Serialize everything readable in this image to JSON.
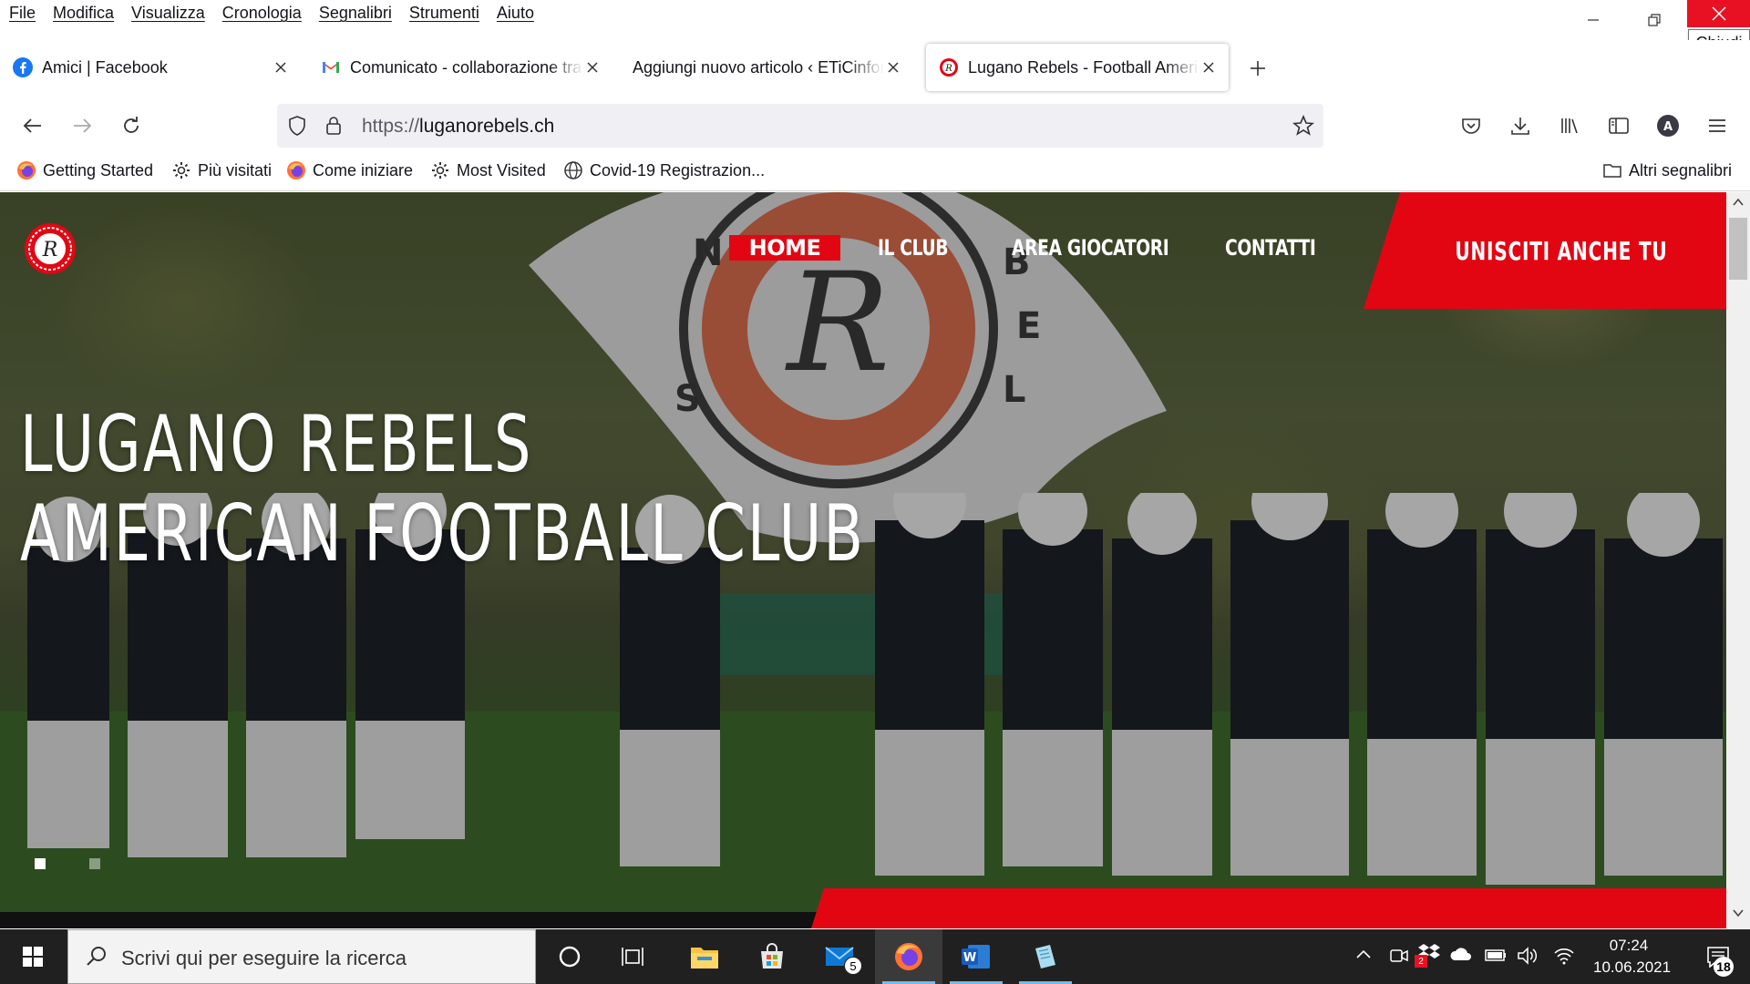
{
  "menubar": {
    "items": [
      "File",
      "Modifica",
      "Visualizza",
      "Cronologia",
      "Segnalibri",
      "Strumenti",
      "Aiuto"
    ],
    "close_tooltip": "Chiudi"
  },
  "tabs": [
    {
      "title": "Amici | Facebook",
      "favicon": "facebook-icon",
      "active": false
    },
    {
      "title": "Comunicato - collaborazione tra",
      "favicon": "gmail-icon",
      "active": false
    },
    {
      "title": "Aggiungi nuovo articolo ‹ ETiCinform",
      "favicon": "none",
      "active": false
    },
    {
      "title": "Lugano Rebels - Football American",
      "favicon": "rebels-icon",
      "active": true
    }
  ],
  "navbar": {
    "url_protocol": "https://",
    "url_host": "luganorebels.ch"
  },
  "bookmarks": [
    {
      "label": "Getting Started",
      "icon": "firefox-icon"
    },
    {
      "label": "Più visitati",
      "icon": "gear-icon"
    },
    {
      "label": "Come iniziare",
      "icon": "firefox-icon"
    },
    {
      "label": "Most Visited",
      "icon": "gear-icon"
    },
    {
      "label": "Covid-19 Registrazion...",
      "icon": "globe-icon"
    }
  ],
  "bookmarks_other": "Altri segnalibri",
  "site": {
    "nav": [
      "HOME",
      "IL CLUB",
      "AREA GIOCATORI",
      "CONTATTI"
    ],
    "cta": "UNISCITI ANCHE TU",
    "hero_line1": "LUGANO REBELS",
    "hero_line2": "AMERICAN FOOTBALL CLUB",
    "accent": "#e20613"
  },
  "taskbar": {
    "search_placeholder": "Scrivi qui per eseguire la ricerca",
    "mail_badge": "5",
    "time": "07:24",
    "date": "10.06.2021",
    "notifications": "18",
    "tray_badge": "2"
  }
}
